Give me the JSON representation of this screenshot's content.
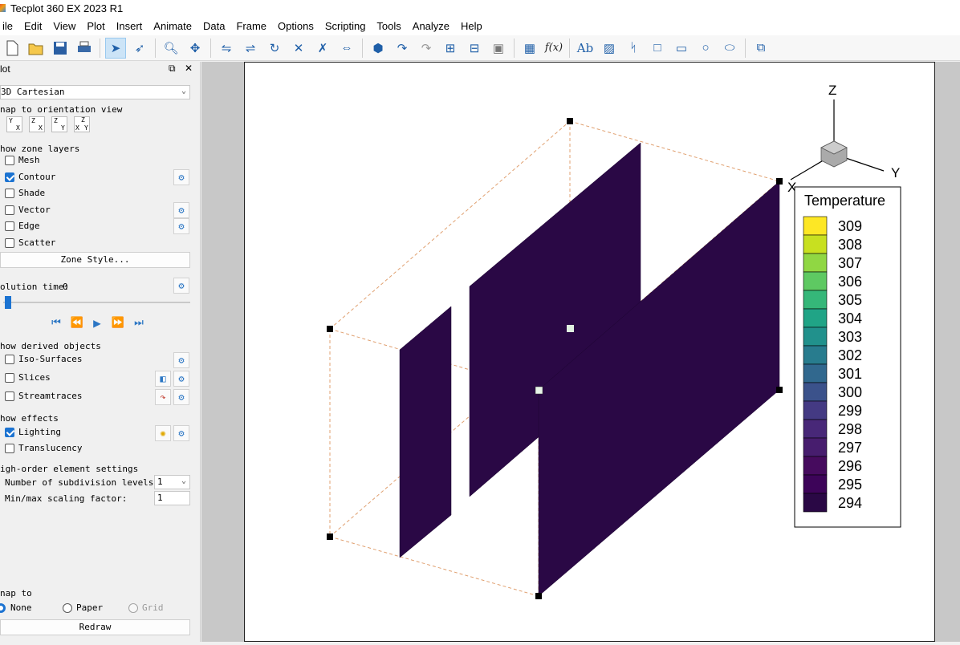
{
  "app": {
    "title": "Tecplot 360 EX 2023 R1"
  },
  "menu": [
    "ile",
    "Edit",
    "View",
    "Plot",
    "Insert",
    "Animate",
    "Data",
    "Frame",
    "Options",
    "Scripting",
    "Tools",
    "Analyze",
    "Help"
  ],
  "toolbar_icons": [
    "new-icon",
    "open-icon",
    "save-icon",
    "print-icon",
    "select-icon",
    "adjust-icon",
    "zoom-icon",
    "translate-icon",
    "rotate-x-icon",
    "rotate-y-icon",
    "rotate-icon",
    "rotate-xy-icon",
    "rotate-xy2-icon",
    "rotate-z-icon",
    "probe-icon",
    "curve-arrow-icon",
    "curve-arrow2-icon",
    "contour-add-icon",
    "contour-remove-icon",
    "contour-label-icon",
    "grid-icon",
    "formula-icon",
    "text-icon",
    "image-icon",
    "polyline-icon",
    "square-icon",
    "rectangle-icon",
    "circle-icon",
    "ellipse-icon",
    "frame-icon"
  ],
  "sidebar": {
    "header": "lot",
    "plot_type": "3D Cartesian",
    "snap_orientation_label": "nap to orientation view",
    "orient_buttons": [
      "YX",
      "ZX",
      "ZY",
      "XYZ"
    ],
    "zone_layers_label": "how zone layers",
    "layers": [
      {
        "label": "Mesh",
        "checked": false
      },
      {
        "label": "Contour",
        "checked": true
      },
      {
        "label": "Shade",
        "checked": false
      },
      {
        "label": "Vector",
        "checked": false
      },
      {
        "label": "Edge",
        "checked": false
      },
      {
        "label": "Scatter",
        "checked": false
      }
    ],
    "zone_style_button": "Zone Style...",
    "solution_time_label": "olution time:",
    "solution_time_value": "0",
    "derived_label": "how derived objects",
    "derived": [
      {
        "label": "Iso-Surfaces",
        "checked": false
      },
      {
        "label": "Slices",
        "checked": false
      },
      {
        "label": "Streamtraces",
        "checked": false
      }
    ],
    "effects_label": "how effects",
    "effects": [
      {
        "label": "Lighting",
        "checked": true
      },
      {
        "label": "Translucency",
        "checked": false
      }
    ],
    "high_order_label": "igh-order element settings",
    "subdiv_label": "Number of subdivision levels:",
    "subdiv_value": "1",
    "scaling_label": "Min/max scaling factor:",
    "scaling_value": "1",
    "snap_to_label": "nap to",
    "snap_options": [
      {
        "label": "None",
        "selected": true
      },
      {
        "label": "Paper",
        "selected": false
      },
      {
        "label": "Grid",
        "selected": false
      }
    ],
    "redraw_button": "Redraw"
  },
  "plot": {
    "axis_x": "X",
    "axis_y": "Y",
    "axis_z": "Z",
    "contour_fill": "#2a0845",
    "legend": {
      "title": "Temperature",
      "levels": [
        "309",
        "308",
        "307",
        "306",
        "305",
        "304",
        "303",
        "302",
        "301",
        "300",
        "299",
        "298",
        "297",
        "296",
        "295",
        "294"
      ],
      "colors": [
        "#fde725",
        "#c8e020",
        "#90d743",
        "#5ec962",
        "#35b779",
        "#20a486",
        "#21918c",
        "#287c8e",
        "#31688e",
        "#3b528b",
        "#443a83",
        "#482878",
        "#471d6e",
        "#460b5e",
        "#3d0459",
        "#2a0845"
      ]
    }
  }
}
